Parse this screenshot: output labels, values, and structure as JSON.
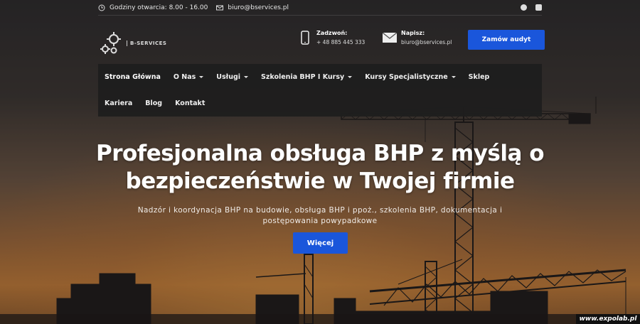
{
  "topbar": {
    "hours": "Godziny otwarcia: 8.00 - 16.00",
    "email": "biuro@bservices.pl",
    "icons": [
      "clock-icon",
      "mail-icon",
      "facebook-icon",
      "linkedin-icon"
    ]
  },
  "header": {
    "logo_text": "B-SERVICES",
    "phone_label": "Zadzwoń:",
    "phone_value": "+ 48 885 445 333",
    "email_label": "Napisz:",
    "email_value": "biuro@bservices.pl",
    "cta_label": "Zamów audyt"
  },
  "nav": {
    "items": [
      {
        "label": "Strona Główna",
        "dropdown": false
      },
      {
        "label": "O Nas",
        "dropdown": true
      },
      {
        "label": "Usługi",
        "dropdown": true
      },
      {
        "label": "Szkolenia BHP I Kursy",
        "dropdown": true
      },
      {
        "label": "Kursy Specjalistyczne",
        "dropdown": true
      },
      {
        "label": "Sklep",
        "dropdown": false
      },
      {
        "label": "Kariera",
        "dropdown": false
      },
      {
        "label": "Blog",
        "dropdown": false
      },
      {
        "label": "Kontakt",
        "dropdown": false
      }
    ]
  },
  "hero": {
    "title_line1": "Profesjonalna obsługa BHP z myślą o",
    "title_line2": "bezpieczeństwie w Twojej firmie",
    "subtitle_line1": "Nadzór i koordynacja BHP na budowie, obsługa BHP i ppoż., szkolenia BHP, dokumentacja i",
    "subtitle_line2": "postępowania powypadkowe",
    "button_label": "Więcej"
  },
  "watermark": "www.expolab.pl",
  "colors": {
    "accent": "#1a56db",
    "nav_bg": "#1e1e1e"
  }
}
